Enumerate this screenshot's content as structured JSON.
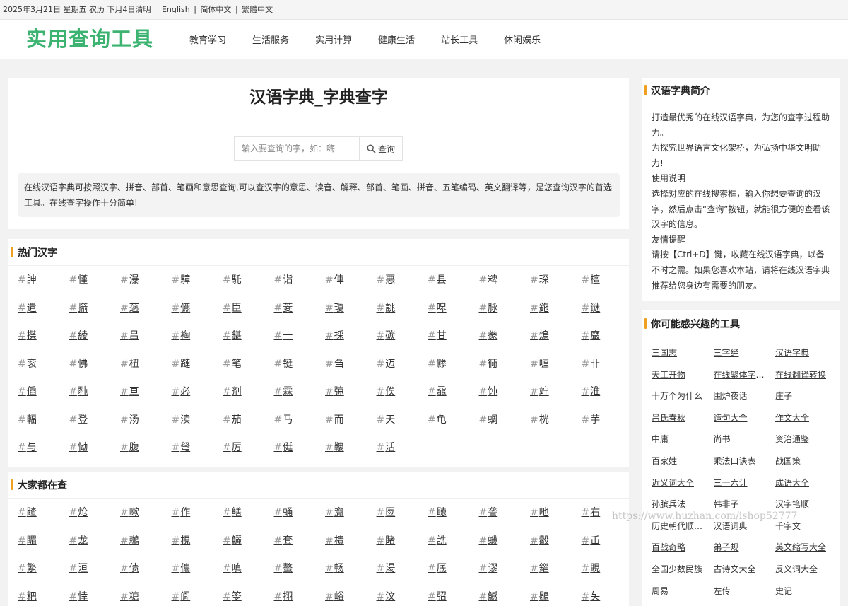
{
  "topbar": {
    "date": "2025年3月21日 星期五 农历 下月4日清明",
    "lang_en": "English",
    "lang_sc": "简体中文",
    "lang_tc": "繁體中文",
    "sep": "|"
  },
  "header": {
    "logo": "实用查询工具",
    "nav": [
      "教育学习",
      "生活服务",
      "实用计算",
      "健康生活",
      "站长工具",
      "休闲娱乐"
    ]
  },
  "main": {
    "title": "汉语字典_字典查字",
    "search_placeholder": "输入要查询的字，如：嗨",
    "search_button": "查询",
    "description": "在线汉语字典可按照汉字、拼音、部首、笔画和意思查询,可以查汉字的意思、读音、解释、部首、笔画、拼音、五笔编码、英文翻译等，是您查询汉字的首选工具。在线查字操作十分简单!"
  },
  "hot": {
    "title": "热门汉字",
    "hash": "#",
    "chars": [
      "訷",
      "慬",
      "瀑",
      "騿",
      "馲",
      "诣",
      "俥",
      "悪",
      "县",
      "粺",
      "琛",
      "檀",
      "遣",
      "擶",
      "薖",
      "儦",
      "臣",
      "菱",
      "瓊",
      "誂",
      "嗥",
      "脉",
      "鉇",
      "谜",
      "揲",
      "綾",
      "吕",
      "裪",
      "鍖",
      "一",
      "採",
      "碳",
      "甘",
      "豢",
      "熓",
      "黀",
      "衮",
      "怫",
      "杻",
      "蹥",
      "笔",
      "铤",
      "刍",
      "迈",
      "黪",
      "衕",
      "喱",
      "卝",
      "偛",
      "豘",
      "亘",
      "必",
      "剂",
      "霖",
      "弶",
      "俟",
      "黿",
      "饨",
      "竚",
      "淮",
      "輻",
      "登",
      "汤",
      "渎",
      "茄",
      "马",
      "而",
      "天",
      "龟",
      "蜩",
      "桄",
      "芋",
      "与",
      "恸",
      "腹",
      "弩",
      "厉",
      "侹",
      "鞻",
      "活"
    ]
  },
  "popular": {
    "title": "大家都在查",
    "chars": [
      "蹅",
      "炝",
      "嗽",
      "作",
      "鳝",
      "蛹",
      "齎",
      "匢",
      "聴",
      "詟",
      "吔",
      "右",
      "睸",
      "龙",
      "鶒",
      "梘",
      "鱺",
      "套",
      "樻",
      "睹",
      "詵",
      "蟣",
      "觳",
      "屲",
      "繁",
      "洹",
      "债",
      "儶",
      "嗔",
      "螯",
      "畅",
      "湯",
      "厎",
      "谬",
      "錙",
      "睍",
      "粑",
      "悻",
      "糖",
      "阆",
      "笭",
      "挧",
      "峪",
      "汶",
      "弨",
      "鱤",
      "鶡",
      "夨"
    ]
  },
  "intro": {
    "title": "汉语字典简介",
    "lines": [
      "打造最优秀的在线汉语字典，为您的查字过程助力。",
      "为探究世界语言文化架桥，为弘扬中华文明助力!",
      "使用说明",
      "选择对应的在线搜索框，输入你想要查询的汉字，然后点击“查询”按钮，就能很方便的查看该汉字的信息。",
      "友情提醒",
      "请按【Ctrl+D】键，收藏在线汉语字典，以备不时之需。如果您喜欢本站，请将在线汉语字典推荐给您身边有需要的朋友。"
    ]
  },
  "tools": {
    "title": "你可能感兴趣的工具",
    "items": [
      "三国志",
      "三字经",
      "汉语字典",
      "天工开物",
      "在线繁体字转换",
      "在线翻译转换",
      "十万个为什么",
      "围炉夜话",
      "庄子",
      "吕氏春秋",
      "造句大全",
      "作文大全",
      "中庸",
      "尚书",
      "资治通鉴",
      "百家姓",
      "乘法口诀表",
      "战国策",
      "近义词大全",
      "三十六计",
      "成语大全",
      "孙膑兵法",
      "韩非子",
      "汉字笔顺",
      "历史朝代顺序表",
      "汉语词典",
      "千字文",
      "百战奇略",
      "弟子规",
      "英文缩写大全",
      "全国少数民族",
      "古诗文大全",
      "反义词大全",
      "周易",
      "左传",
      "史记"
    ]
  },
  "watermark": "https://www.huzhan.com/ishop52777",
  "colors": {
    "logo": "#3cb371",
    "accent_bar": "#f0a020"
  }
}
